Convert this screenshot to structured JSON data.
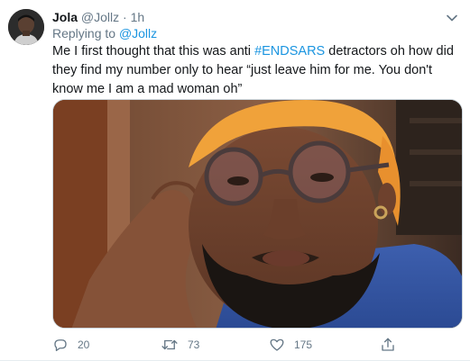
{
  "tweet": {
    "display_name": "Jola",
    "handle": "@Jollz",
    "separator": "·",
    "time": "1h",
    "replying_prefix": "Replying to",
    "replying_to": "@Jollz",
    "text_part1": "Me I first thought that this was anti ",
    "hashtag": "#ENDSARS",
    "text_part2": " detractors oh how did they find my number only to hear “just leave him for me. You don't know me I am a mad woman oh”",
    "media_description": "Photo of a man with orange-dyed hair, round glasses and a beard, resting his head on his hand"
  },
  "actions": {
    "reply_icon": "reply-icon",
    "reply_count": "20",
    "retweet_icon": "retweet-icon",
    "retweet_count": "73",
    "like_icon": "heart-icon",
    "like_count": "175",
    "share_icon": "share-icon"
  },
  "colors": {
    "link_blue": "#1b95e0",
    "secondary_text": "#657786",
    "primary_text": "#14171a",
    "icon_gray": "#657786"
  }
}
